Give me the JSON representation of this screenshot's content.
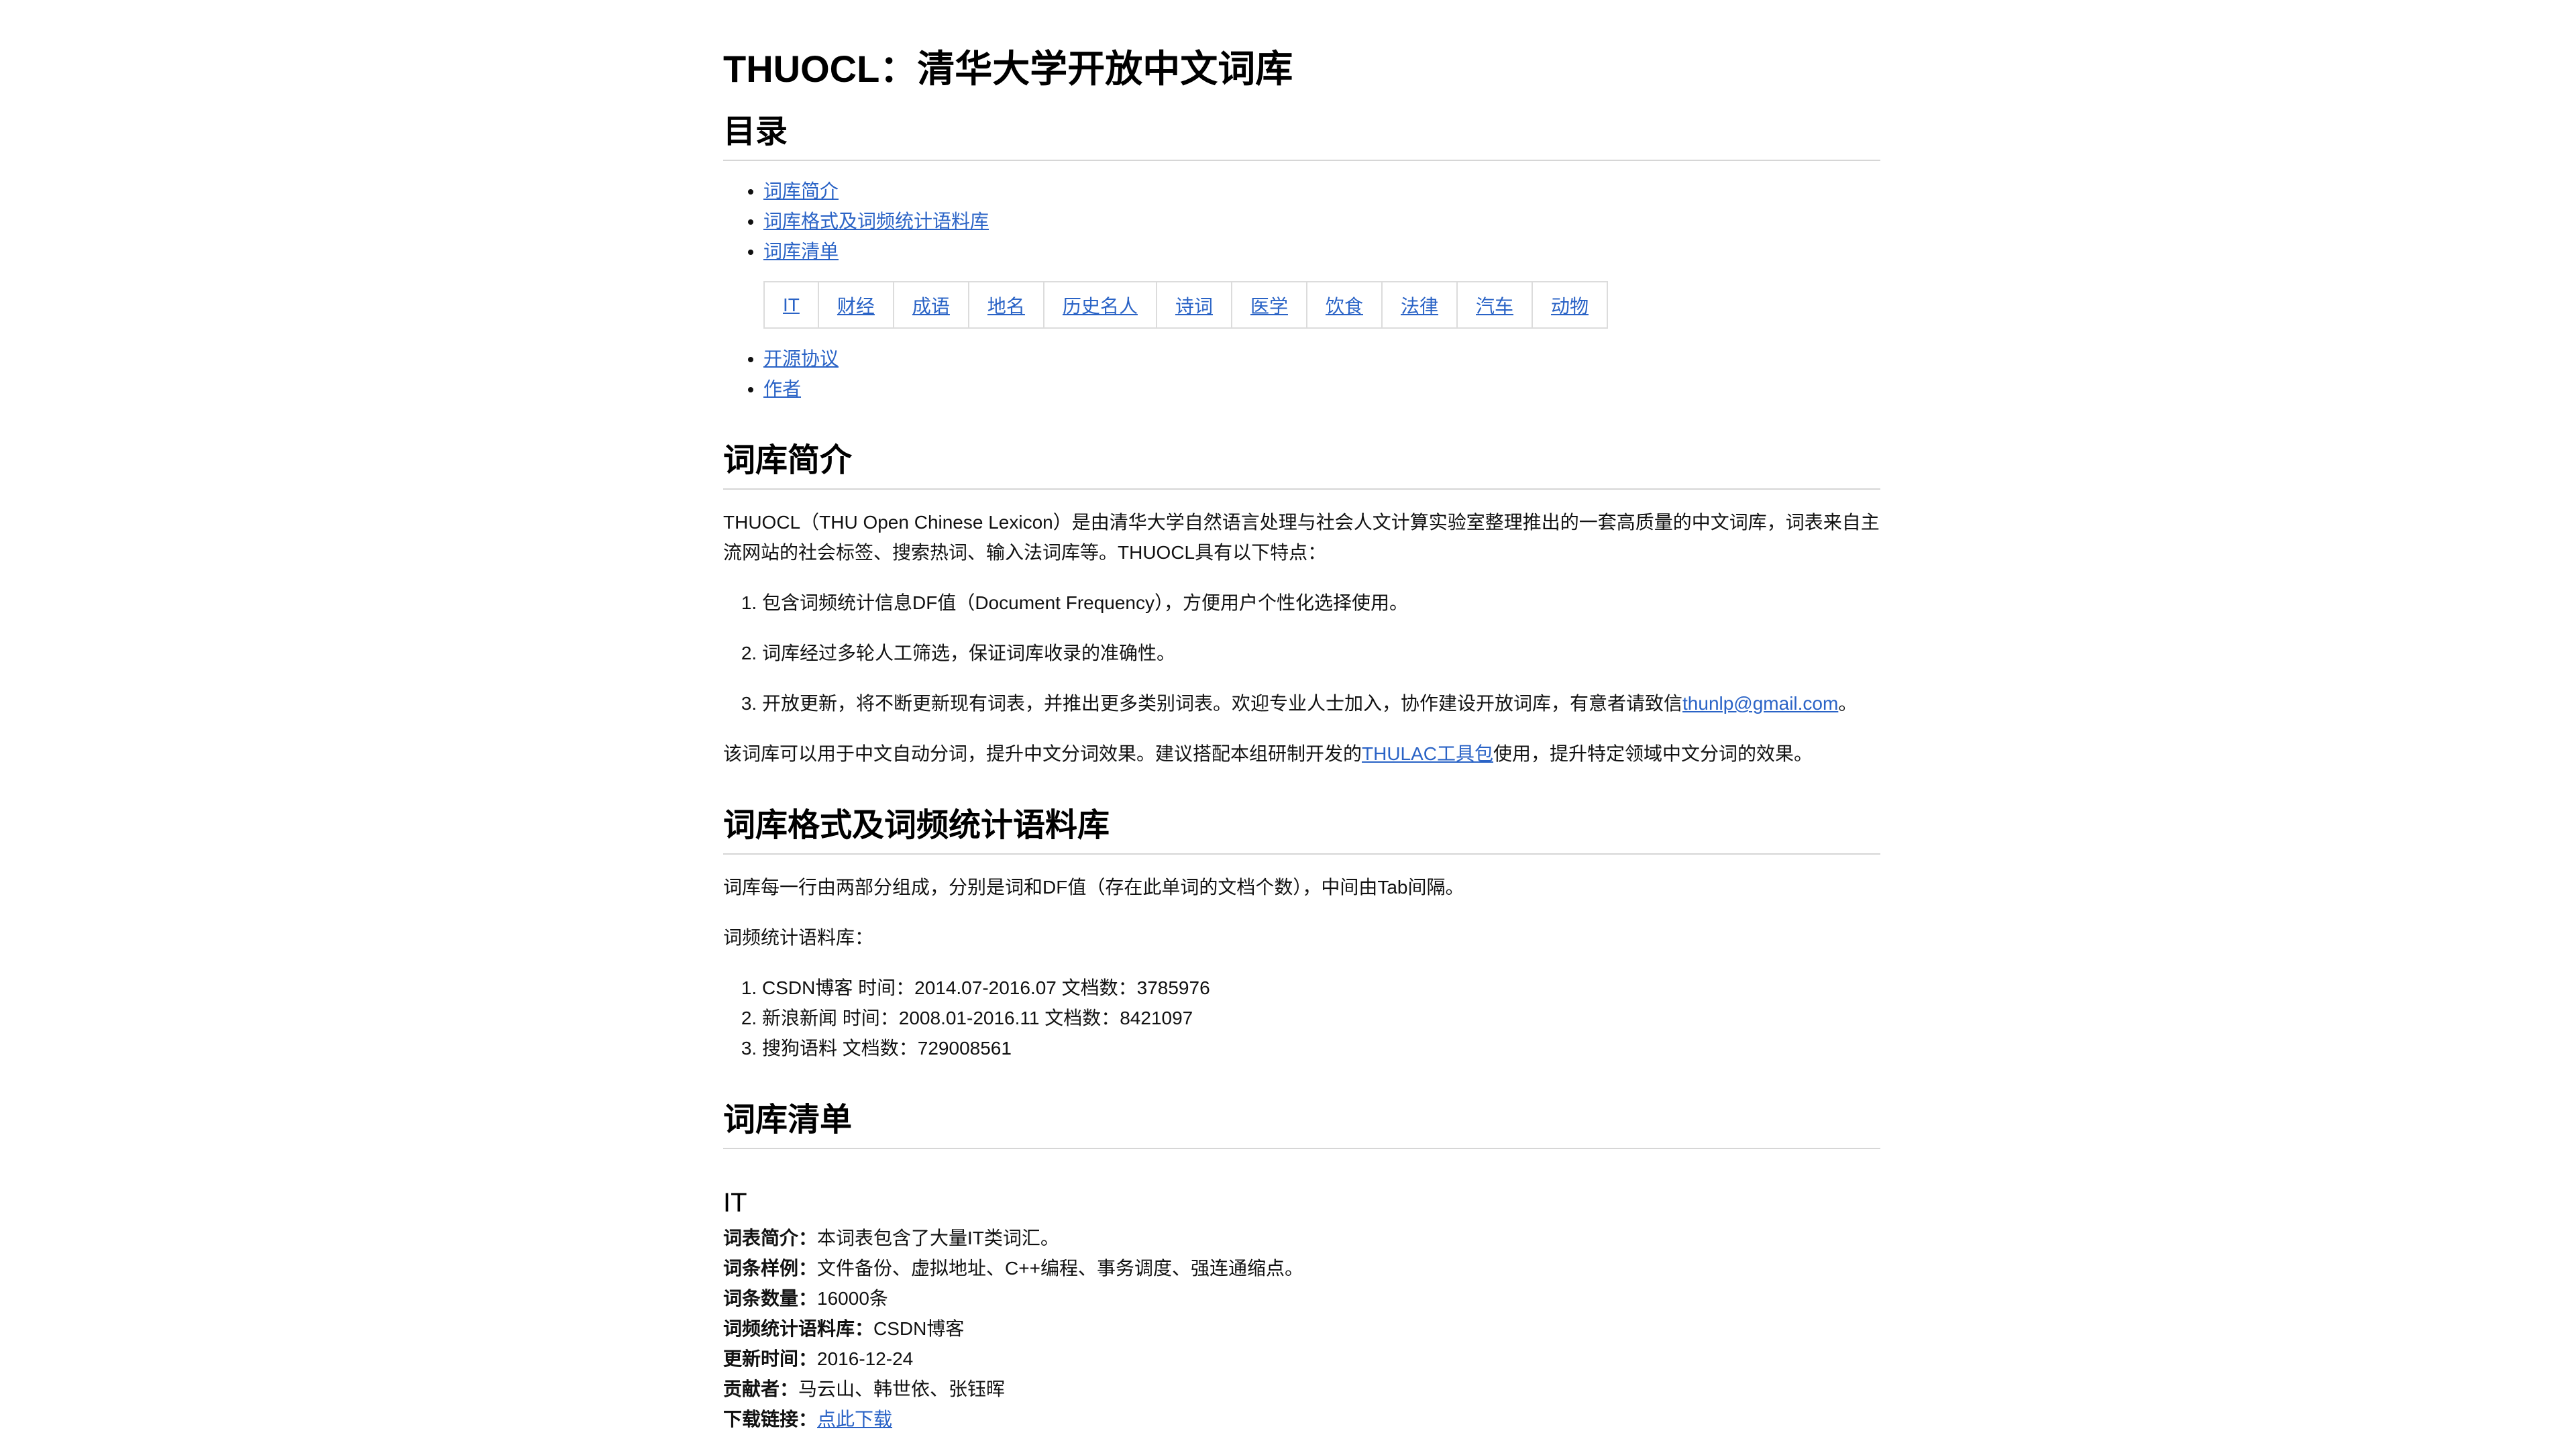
{
  "title": "THUOCL：清华大学开放中文词库",
  "toc": {
    "heading": "目录",
    "items": [
      "词库简介",
      "词库格式及词频统计语料库",
      "词库清单"
    ],
    "categories": [
      "IT",
      "财经",
      "成语",
      "地名",
      "历史名人",
      "诗词",
      "医学",
      "饮食",
      "法律",
      "汽车",
      "动物"
    ],
    "items_after": [
      "开源协议",
      "作者"
    ]
  },
  "intro": {
    "heading": "词库简介",
    "para1": "THUOCL（THU Open Chinese Lexicon）是由清华大学自然语言处理与社会人文计算实验室整理推出的一套高质量的中文词库，词表来自主流网站的社会标签、搜索热词、输入法词库等。THUOCL具有以下特点：",
    "features": [
      "包含词频统计信息DF值（Document Frequency），方便用户个性化选择使用。",
      "词库经过多轮人工筛选，保证词库收录的准确性。"
    ],
    "feature3_text": "开放更新，将不断更新现有词表，并推出更多类别词表。欢迎专业人士加入，协作建设开放词库，有意者请致信",
    "feature3_email": "thunlp@gmail.com",
    "feature3_end": "。",
    "para2_before": "该词库可以用于中文自动分词，提升中文分词效果。建议搭配本组研制开发的",
    "para2_link": "THULAC工具包",
    "para2_after": "使用，提升特定领域中文分词的效果。"
  },
  "format": {
    "heading": "词库格式及词频统计语料库",
    "para1": "词库每一行由两部分组成，分别是词和DF值（存在此单词的文档个数），中间由Tab间隔。",
    "para2": "词频统计语料库：",
    "corpora": [
      "CSDN博客 时间：2014.07-2016.07 文档数：3785976",
      "新浪新闻 时间：2008.01-2016.11 文档数：8421097",
      "搜狗语料 文档数：729008561"
    ]
  },
  "list": {
    "heading": "词库清单",
    "it": {
      "heading": "IT",
      "rows": [
        {
          "key": "词表简介",
          "value": "本词表包含了大量IT类词汇。"
        },
        {
          "key": "词条样例",
          "value": "文件备份、虚拟地址、C++编程、事务调度、强连通缩点。"
        },
        {
          "key": "词条数量",
          "value": "16000条"
        },
        {
          "key": "词频统计语料库",
          "value": "CSDN博客"
        },
        {
          "key": "更新时间",
          "value": "2016-12-24"
        },
        {
          "key": "贡献者",
          "value": "马云山、韩世依、张钰晖"
        }
      ],
      "download_key": "下载链接",
      "download_link": "点此下载"
    }
  },
  "colors": {
    "link": "#2a63c6",
    "text": "#111111",
    "rule": "#d6d6d6"
  }
}
